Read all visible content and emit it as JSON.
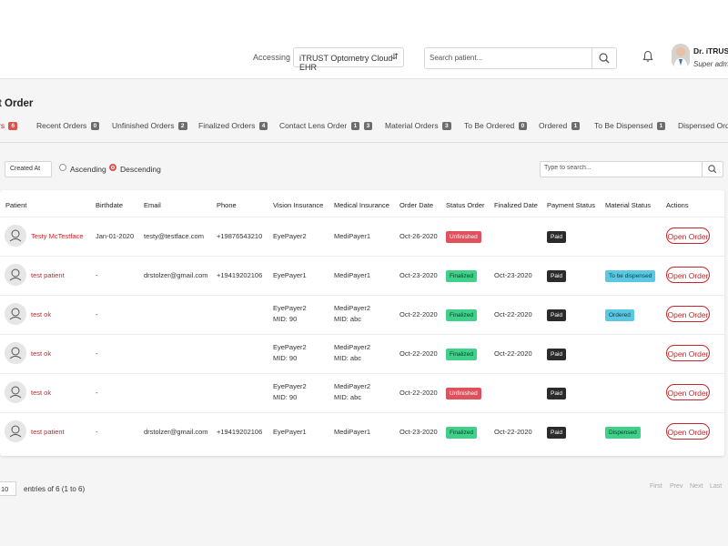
{
  "header": {
    "accessing_label": "Accessing",
    "practice": "iTRUST Optometry Cloud EHR",
    "search_placeholder": "Search patient...",
    "user_name": "Dr. iTRUST",
    "user_role": "Super adm"
  },
  "page_title": "t Order",
  "tabs": [
    {
      "label": "rs",
      "count": "6",
      "active": true
    },
    {
      "label": "Recent Orders",
      "count": "0"
    },
    {
      "label": "Unfinished Orders",
      "count": "2"
    },
    {
      "label": "Finalized Orders",
      "count": "4"
    },
    {
      "label": "Contact Lens Order",
      "count": "1",
      "count2": "3"
    },
    {
      "label": "Material Orders",
      "count": "3"
    },
    {
      "label": "To Be Ordered",
      "count": "0"
    },
    {
      "label": "Ordered",
      "count": "1"
    },
    {
      "label": "To Be Dispensed",
      "count": "1"
    },
    {
      "label": "Dispensed Order",
      "count": ""
    }
  ],
  "filters": {
    "sort_value": "Created At",
    "ascending_label": "Ascending",
    "descending_label": "Descending",
    "search_placeholder": "Type to search..."
  },
  "table": {
    "columns": [
      "Patient",
      "Birthdate",
      "Email",
      "Phone",
      "Vision Insurance",
      "Medical Insurance",
      "Order Date",
      "Status Order",
      "Finalized Date",
      "Payment Status",
      "Material Status",
      "Actions"
    ],
    "rows": [
      {
        "patient": "Testy McTestface",
        "birthdate": "Jan-01-2020",
        "email": "testy@testface.com",
        "phone": "+19876543210",
        "vision": "EyePayer2",
        "vision_mid": "",
        "medical": "MediPayer1",
        "medical_mid": "",
        "order_date": "Oct-26-2020",
        "status": "Unfinished",
        "finalized": "",
        "payment": "Paid",
        "material": "",
        "action": "Open Order"
      },
      {
        "patient": "test patient",
        "birthdate": "-",
        "email": "drstolzer@gmail.com",
        "phone": "+19419202106",
        "vision": "EyePayer1",
        "vision_mid": "",
        "medical": "MediPayer1",
        "medical_mid": "",
        "order_date": "Oct-23-2020",
        "status": "Finalized",
        "finalized": "Oct-23-2020",
        "payment": "Paid",
        "material": "To be dispensed",
        "action": "Open Order"
      },
      {
        "patient": "test ok",
        "birthdate": "-",
        "email": "",
        "phone": "",
        "vision": "EyePayer2",
        "vision_mid": "MID: 90",
        "medical": "MediPayer2",
        "medical_mid": "MID: abc",
        "order_date": "Oct-22-2020",
        "status": "Finalized",
        "finalized": "Oct-22-2020",
        "payment": "Paid",
        "material": "Ordered",
        "action": "Open Order"
      },
      {
        "patient": "test ok",
        "birthdate": "-",
        "email": "",
        "phone": "",
        "vision": "EyePayer2",
        "vision_mid": "MID: 90",
        "medical": "MediPayer2",
        "medical_mid": "MID: abc",
        "order_date": "Oct-22-2020",
        "status": "Finalized",
        "finalized": "Oct-22-2020",
        "payment": "Paid",
        "material": "",
        "action": "Open Order"
      },
      {
        "patient": "test ok",
        "birthdate": "-",
        "email": "",
        "phone": "",
        "vision": "EyePayer2",
        "vision_mid": "MID: 90",
        "medical": "MediPayer2",
        "medical_mid": "MID: abc",
        "order_date": "Oct-22-2020",
        "status": "Unfinished",
        "finalized": "",
        "payment": "Paid",
        "material": "",
        "action": "Open Order"
      },
      {
        "patient": "test patient",
        "birthdate": "-",
        "email": "drstolzer@gmail.com",
        "phone": "+19419202106",
        "vision": "EyePayer1",
        "vision_mid": "",
        "medical": "MediPayer1",
        "medical_mid": "",
        "order_date": "Oct-23-2020",
        "status": "Finalized",
        "finalized": "Oct-22-2020",
        "payment": "Paid",
        "material": "Dispensed",
        "action": "Open Order"
      }
    ]
  },
  "footer": {
    "page_size": "10",
    "entries_text": "entries of 6 (1 to 6)",
    "first": "First",
    "prev": "Prev",
    "next": "Next",
    "last": "Last"
  },
  "colors": {
    "accent": "#c3272b",
    "unfinished": "#e0515e",
    "finalized": "#3fd18a",
    "material": "#5bc8e3",
    "paid": "#2b2b2b"
  },
  "icons": [
    "search-icon",
    "bell-icon",
    "caret-updown-icon",
    "patient-avatar-icon"
  ]
}
